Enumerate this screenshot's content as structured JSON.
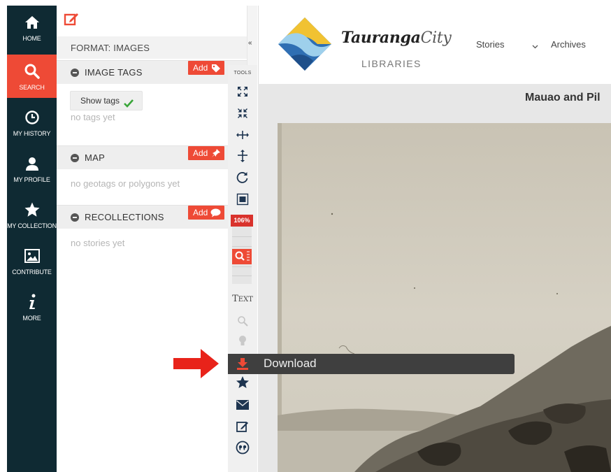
{
  "nav": {
    "items": [
      {
        "label": "HOME",
        "icon": "home-icon"
      },
      {
        "label": "SEARCH",
        "icon": "search-icon",
        "active": true
      },
      {
        "label": "MY HISTORY",
        "icon": "clock-icon"
      },
      {
        "label": "MY PROFILE",
        "icon": "user-icon"
      },
      {
        "label": "MY COLLECTION",
        "icon": "star-icon"
      },
      {
        "label": "CONTRIBUTE",
        "icon": "image-icon"
      },
      {
        "label": "MORE",
        "icon": "info-icon"
      }
    ]
  },
  "panel": {
    "format": "FORMAT: IMAGES",
    "sections": {
      "tags": {
        "title": "IMAGE TAGS",
        "add_label": "Add",
        "show_tags_label": "Show tags",
        "empty_text": "no tags yet"
      },
      "map": {
        "title": "MAP",
        "add_label": "Add",
        "empty_text": "no geotags or polygons yet"
      },
      "recollections": {
        "title": "RECOLLECTIONS",
        "add_label": "Add",
        "empty_text": "no stories yet"
      }
    }
  },
  "toolbar": {
    "tools_label": "TOOLS",
    "zoom_percent": "106%",
    "text_tool_label": "TEXT",
    "download_label": "Download"
  },
  "header": {
    "logo_word": "Tauranga",
    "logo_city": "City",
    "logo_sub": "LIBRARIES",
    "links": {
      "stories": "Stories",
      "archives": "Archives"
    }
  },
  "viewer": {
    "title": "Mauao and Pil"
  },
  "colors": {
    "accent": "#ee4a36",
    "nav_bg": "#0f2a33",
    "toolbar_icon": "#1e3550"
  }
}
